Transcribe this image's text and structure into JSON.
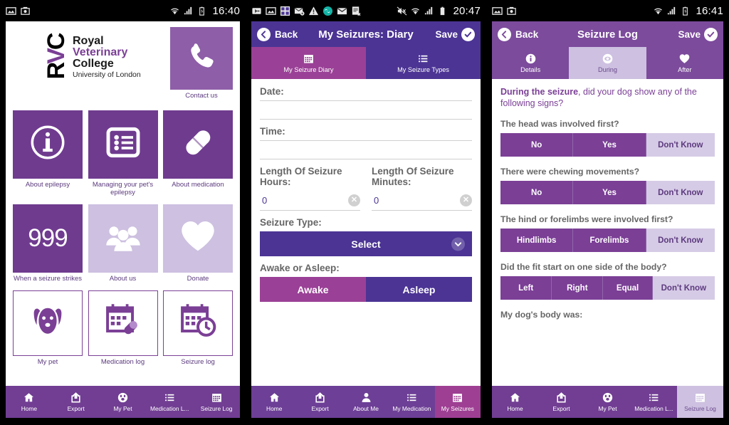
{
  "panel1": {
    "statusbar": {
      "time": "16:40",
      "icons": [
        "image-icon",
        "screenshot-icon",
        "wifi-icon",
        "signal-icon",
        "battery-icon"
      ]
    },
    "logo": {
      "mark": "RVC",
      "line1": "Royal",
      "line2": "Veterinary",
      "line3": "College",
      "line4": "University of London"
    },
    "contact": {
      "label": "Contact us",
      "icon": "phone-icon"
    },
    "tiles": [
      {
        "label": "About epilepsy",
        "icon": "info-icon",
        "style": "dark"
      },
      {
        "label": "Managing your pet's epilepsy",
        "icon": "list-box-icon",
        "style": "dark"
      },
      {
        "label": "About medication",
        "icon": "pill-icon",
        "style": "dark"
      },
      {
        "label": "When a seizure strikes",
        "icon": "999-text",
        "style": "dark",
        "text": "999"
      },
      {
        "label": "About us",
        "icon": "people-icon",
        "style": "light"
      },
      {
        "label": "Donate",
        "icon": "heart-icon",
        "style": "light"
      },
      {
        "label": "My pet",
        "icon": "dog-icon",
        "style": "outline"
      },
      {
        "label": "Medication log",
        "icon": "calendar-pill-icon",
        "style": "outline"
      },
      {
        "label": "Seizure log",
        "icon": "calendar-clock-icon",
        "style": "outline"
      }
    ],
    "nav": [
      {
        "label": "Home",
        "icon": "home-icon",
        "active": false
      },
      {
        "label": "Export",
        "icon": "export-icon",
        "active": false
      },
      {
        "label": "My Pet",
        "icon": "paw-icon",
        "active": false
      },
      {
        "label": "Medication L...",
        "icon": "list-icon",
        "active": false
      },
      {
        "label": "Seizure Log",
        "icon": "calendar-icon",
        "active": false
      }
    ]
  },
  "panel2": {
    "statusbar": {
      "time": "20:47",
      "icons": [
        "usb-icon",
        "image-icon",
        "apps-icon",
        "mail-sync-icon",
        "warning-icon",
        "infinity-icon",
        "gmail-icon",
        "doc-x-icon",
        "mute-icon",
        "wifi-icon",
        "signal-icon",
        "battery-icon"
      ]
    },
    "header": {
      "back": "Back",
      "title": "My Seizures: Diary",
      "save": "Save"
    },
    "tabs": [
      {
        "label": "My Seizure Diary",
        "icon": "calendar-icon",
        "active": true
      },
      {
        "label": "My Seizure Types",
        "icon": "list-icon",
        "active": false
      }
    ],
    "form": {
      "date_label": "Date:",
      "date_value": "",
      "time_label": "Time:",
      "time_value": "",
      "hours_label": "Length Of Seizure Hours:",
      "hours_value": "0",
      "minutes_label": "Length Of Seizure Minutes:",
      "minutes_value": "0",
      "seizure_type_label": "Seizure Type:",
      "seizure_type_value": "Select",
      "awake_label": "Awake or Asleep:",
      "awake_option": "Awake",
      "asleep_option": "Asleep"
    },
    "nav": [
      {
        "label": "Home",
        "icon": "home-icon",
        "active": false
      },
      {
        "label": "Export",
        "icon": "export-icon",
        "active": false
      },
      {
        "label": "About Me",
        "icon": "person-icon",
        "active": false
      },
      {
        "label": "My Medication",
        "icon": "list-icon",
        "active": false
      },
      {
        "label": "My Seizures",
        "icon": "calendar-icon",
        "active": true
      }
    ]
  },
  "panel3": {
    "statusbar": {
      "time": "16:41",
      "icons": [
        "image-icon",
        "screenshot-icon",
        "wifi-icon",
        "signal-icon",
        "battery-icon"
      ]
    },
    "header": {
      "back": "Back",
      "title": "Seizure Log",
      "save": "Save"
    },
    "tabs": [
      {
        "label": "Details",
        "icon": "info-icon",
        "active": false
      },
      {
        "label": "During",
        "icon": "eye-icon",
        "active": true
      },
      {
        "label": "After",
        "icon": "heart-icon",
        "active": false
      }
    ],
    "intro_bold": "During the seizure",
    "intro_rest": ", did your dog show any of the following signs?",
    "questions": [
      {
        "text": "The head was involved first?",
        "options": [
          "No",
          "Yes",
          "Don't Know"
        ],
        "widths": [
          34,
          34,
          32
        ]
      },
      {
        "text": "There were chewing movements?",
        "options": [
          "No",
          "Yes",
          "Don't Know"
        ],
        "widths": [
          34,
          34,
          32
        ]
      },
      {
        "text": "The hind or forelimbs were involved first?",
        "options": [
          "Hindlimbs",
          "Forelimbs",
          "Don't Know"
        ],
        "widths": [
          34,
          34,
          32
        ]
      },
      {
        "text": "Did the fit start on one side of the body?",
        "options": [
          "Left",
          "Right",
          "Equal",
          "Don't Know"
        ],
        "widths": [
          24,
          24,
          23,
          29
        ]
      }
    ],
    "cut_question": "My dog's body was:",
    "nav": [
      {
        "label": "Home",
        "icon": "home-icon",
        "active": false
      },
      {
        "label": "Export",
        "icon": "export-icon",
        "active": false
      },
      {
        "label": "My Pet",
        "icon": "paw-icon",
        "active": false
      },
      {
        "label": "Medication L...",
        "icon": "list-icon",
        "active": false
      },
      {
        "label": "Seizure Log",
        "icon": "calendar-icon",
        "active": true
      }
    ]
  },
  "colors": {
    "brand_purple": "#7b3f96",
    "deep_blue_purple": "#4b3494",
    "magenta": "#9a4096",
    "light_lavender": "#cdc0e0",
    "tile_dark": "#6f3b8f"
  }
}
